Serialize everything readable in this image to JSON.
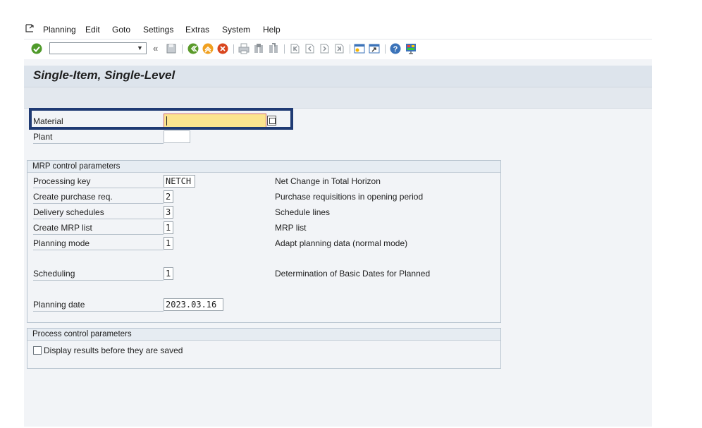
{
  "menu": {
    "items": [
      "Planning",
      "Edit",
      "Goto",
      "Settings",
      "Extras",
      "System",
      "Help"
    ]
  },
  "toolbar": {
    "command_value": "",
    "icons": [
      "enter-icon",
      "save-icon",
      "back-icon",
      "exit-icon",
      "cancel-icon",
      "print-icon",
      "find-icon",
      "find-next-icon",
      "first-page-icon",
      "previous-page-icon",
      "next-page-icon",
      "last-page-icon",
      "create-session-icon",
      "shortcut-icon",
      "help-icon",
      "customize-layout-icon"
    ]
  },
  "title": "Single-Item, Single-Level",
  "selection": {
    "material_label": "Material",
    "material_value": "",
    "plant_label": "Plant",
    "plant_value": ""
  },
  "mrp_group": {
    "header": "MRP control parameters",
    "rows": [
      {
        "label": "Processing key",
        "value": "NETCH",
        "desc": "Net Change in Total Horizon"
      },
      {
        "label": "Create purchase req.",
        "value": "2",
        "desc": "Purchase requisitions in opening period"
      },
      {
        "label": "Delivery schedules",
        "value": "3",
        "desc": "Schedule lines"
      },
      {
        "label": "Create MRP list",
        "value": "1",
        "desc": "MRP list"
      },
      {
        "label": "Planning mode",
        "value": "1",
        "desc": "Adapt planning data (normal mode)"
      },
      {
        "label": "Scheduling",
        "value": "1",
        "desc": "Determination of Basic Dates for Planned"
      },
      {
        "label": "Planning date",
        "value": "2023.03.16",
        "desc": ""
      }
    ]
  },
  "process_group": {
    "header": "Process control parameters",
    "display_results_label": "Display results before they are saved",
    "display_results_checked": false
  },
  "colors": {
    "focus_frame": "#1f3a73",
    "required_field": "#fbe48f",
    "title_bar": "#dde4ec"
  }
}
